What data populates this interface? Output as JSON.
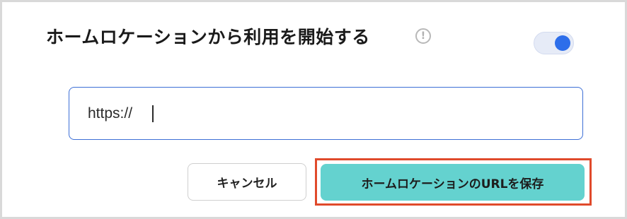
{
  "header": {
    "title": "ホームロケーションから利用を開始する",
    "info_symbol": "!"
  },
  "toggle": {
    "state": "on",
    "accent_color": "#2d6eea"
  },
  "url_field": {
    "value": "https://"
  },
  "actions": {
    "cancel_label": "キャンセル",
    "save_label": "ホームロケーションのURLを保存",
    "save_color": "#64d2cf",
    "highlight_color": "#e04a2b"
  }
}
